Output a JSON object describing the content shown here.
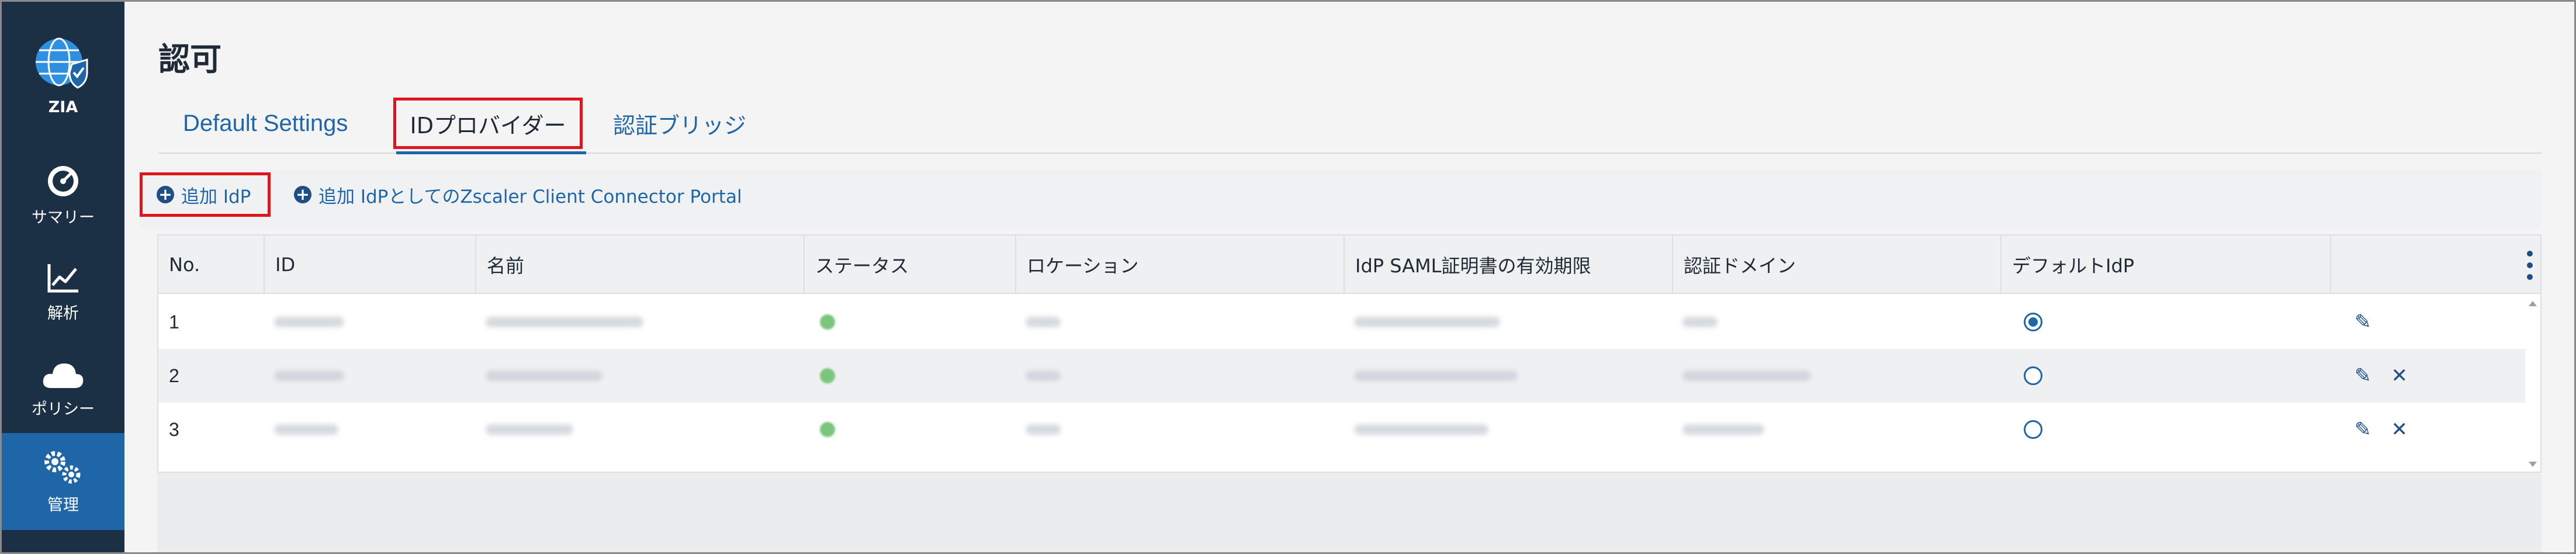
{
  "sidebar": {
    "logo_label": "ZIA",
    "items": [
      {
        "label": "サマリー",
        "icon": "dashboard-gauge-icon"
      },
      {
        "label": "解析",
        "icon": "line-chart-icon"
      },
      {
        "label": "ポリシー",
        "icon": "cloud-icon"
      },
      {
        "label": "管理",
        "icon": "gears-icon",
        "active": true
      }
    ]
  },
  "page": {
    "title": "認可"
  },
  "tabs": [
    {
      "label": "Default Settings"
    },
    {
      "label": "IDプロバイダー",
      "active": true
    },
    {
      "label": "認証ブリッジ"
    }
  ],
  "toolbar": {
    "add_idp": "追加 IdP",
    "add_zcc_portal": "追加 IdPとしてのZscaler Client Connector Portal"
  },
  "table": {
    "columns": [
      "No.",
      "ID",
      "名前",
      "ステータス",
      "ロケーション",
      "IdP SAML証明書の有効期限",
      "認証ドメイン",
      "デフォルトIdP"
    ],
    "rows": [
      {
        "no": "1",
        "default": true,
        "actions": [
          "edit"
        ]
      },
      {
        "no": "2",
        "default": false,
        "actions": [
          "edit",
          "delete"
        ]
      },
      {
        "no": "3",
        "default": false,
        "actions": [
          "edit",
          "delete"
        ]
      }
    ]
  },
  "colors": {
    "sidebar_bg": "#1b2f45",
    "sidebar_active": "#1f66a8",
    "accent": "#1f66a8",
    "highlight_box": "#e0141c",
    "status_green": "#7bc67e"
  }
}
